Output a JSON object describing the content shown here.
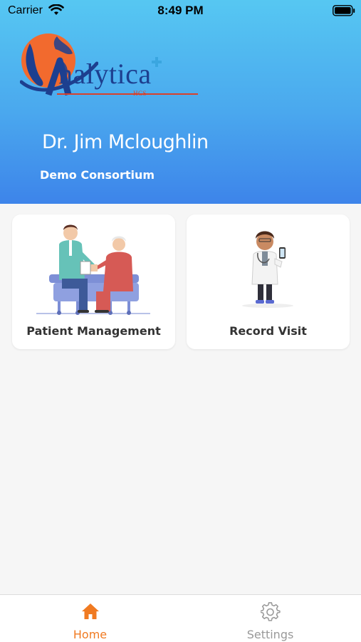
{
  "status_bar": {
    "carrier": "Carrier",
    "time": "8:49 PM"
  },
  "logo": {
    "word": "nalytica",
    "sub": "HCS"
  },
  "profile": {
    "doctor_name": "Dr. Jim Mcloughlin",
    "organization": "Demo Consortium"
  },
  "cards": [
    {
      "label": "Patient Management",
      "icon": "patient-care-illustration"
    },
    {
      "label": "Record Visit",
      "icon": "doctor-tablet-illustration"
    }
  ],
  "tabbar": {
    "home_label": "Home",
    "settings_label": "Settings",
    "active_color": "#f07a21",
    "inactive_color": "#999999"
  },
  "colors": {
    "header_top": "#56c7f2",
    "header_bottom": "#3d84ea",
    "background": "#f6f6f6"
  }
}
